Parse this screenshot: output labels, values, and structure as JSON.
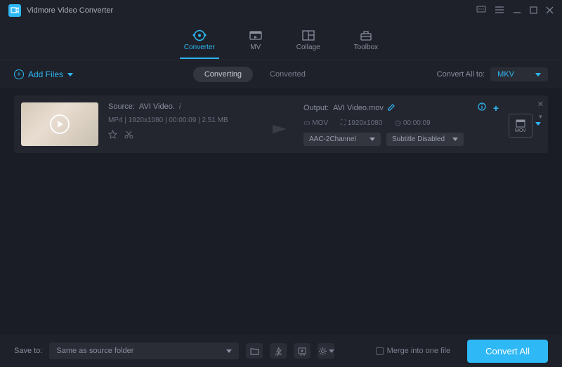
{
  "app": {
    "title": "Vidmore Video Converter"
  },
  "nav": {
    "converter": "Converter",
    "mv": "MV",
    "collage": "Collage",
    "toolbox": "Toolbox"
  },
  "toolbar": {
    "add_files": "Add Files",
    "converting": "Converting",
    "converted": "Converted",
    "convert_all_to": "Convert All to:",
    "format": "MKV"
  },
  "file": {
    "source_label": "Source:",
    "source_name": "AVI Video.",
    "meta_format": "MP4",
    "meta_res": "1920x1080",
    "meta_dur": "00:00:09",
    "meta_size": "2.51 MB",
    "output_label": "Output:",
    "output_name": "AVI Video.mov",
    "out_container": "MOV",
    "out_res": "1920x1080",
    "out_dur": "00:00:09",
    "audio_select": "AAC-2Channel",
    "subtitle_select": "Subtitle Disabled",
    "format_badge": "MOV"
  },
  "footer": {
    "save_to": "Save to:",
    "save_path": "Same as source folder",
    "merge": "Merge into one file",
    "convert_all": "Convert All"
  }
}
